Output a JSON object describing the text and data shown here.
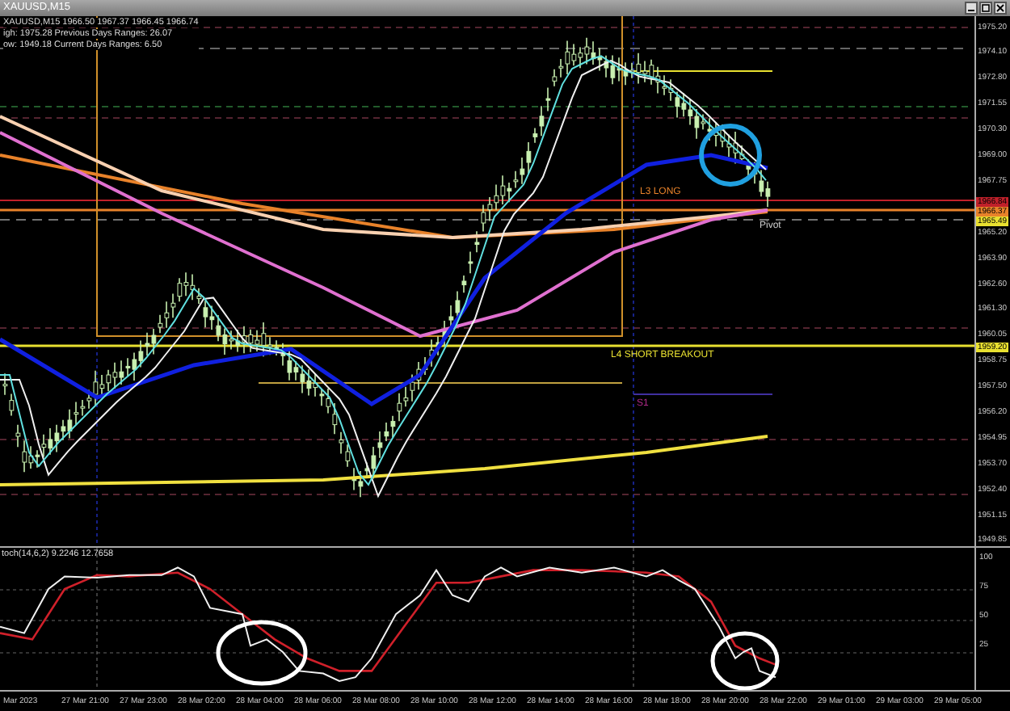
{
  "window": {
    "title": "XAUUSD,M15"
  },
  "info_lines": [
    "XAUUSD,M15  1966.50  1967.37  1966.45  1966.74",
    "igh: 1975.28    Previous Days Ranges: 26.07",
    "ow: 1949.18    Current Days Ranges: 6.50"
  ],
  "chart_labels": [
    "L3 LONG",
    "Pivot",
    "L4 SHORT BREAKOUT",
    "S1"
  ],
  "price_axis": [
    "1975.20",
    "1974.10",
    "1972.80",
    "1971.55",
    "1970.30",
    "1969.00",
    "1967.75",
    "1965.20",
    "1963.90",
    "1962.60",
    "1961.30",
    "1960.05",
    "1958.75",
    "1957.50",
    "1956.20",
    "1954.95",
    "1953.70",
    "1952.40",
    "1951.15",
    "1949.85"
  ],
  "price_markers": [
    {
      "label": "1966.84",
      "color": "#c0202a"
    },
    {
      "label": "1966.37",
      "color": "#e8822a"
    },
    {
      "label": "1965.49",
      "color": "#e8e030"
    },
    {
      "label": "1959.20",
      "color": "#e8e030"
    }
  ],
  "stochastic": {
    "label": "toch(14,6,2) 9.2246 12.7658",
    "axis": [
      "100",
      "75",
      "50",
      "25"
    ]
  },
  "time_axis": [
    "Mar 2023",
    "27 Mar 21:00",
    "27 Mar 23:00",
    "28 Mar 02:00",
    "28 Mar 04:00",
    "28 Mar 06:00",
    "28 Mar 08:00",
    "28 Mar 10:00",
    "28 Mar 12:00",
    "28 Mar 14:00",
    "28 Mar 16:00",
    "28 Mar 18:00",
    "28 Mar 20:00",
    "28 Mar 22:00",
    "29 Mar 01:00",
    "29 Mar 03:00",
    "29 Mar 05:00"
  ]
}
